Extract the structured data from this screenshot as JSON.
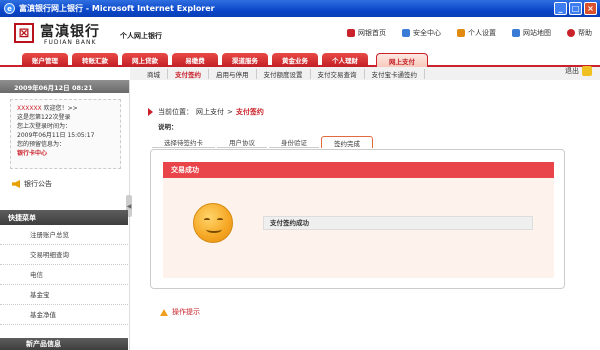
{
  "window": {
    "title": "富滇银行网上银行 - Microsoft Internet Explorer",
    "buttons": [
      "_",
      "□",
      "×"
    ]
  },
  "header": {
    "logo_text": "富滇银行",
    "logo_en": "FUDIAN BANK",
    "subtitle": "个人网上银行",
    "links": [
      {
        "label": "网银首页",
        "icon": "home-icon",
        "color": "#c9222a"
      },
      {
        "label": "安全中心",
        "icon": "shield-icon",
        "color": "#3a7bd5"
      },
      {
        "label": "个人设置",
        "icon": "user-icon",
        "color": "#e08a10"
      },
      {
        "label": "网站地图",
        "icon": "map-icon",
        "color": "#3a7bd5"
      },
      {
        "label": "帮助",
        "icon": "help-icon",
        "color": "#c9222a"
      }
    ]
  },
  "nav": {
    "tabs": [
      "账户管理",
      "转账汇款",
      "网上贷款",
      "易缴费",
      "渠道服务",
      "黄金业务",
      "个人理财",
      "网上支付"
    ],
    "active": "网上支付"
  },
  "subnav": {
    "items": [
      "商城",
      "支付签约",
      "启用与停用",
      "支付额度设置",
      "支付交易查询",
      "支付宝卡通签约"
    ],
    "current": "支付签约",
    "logout": "退出"
  },
  "sidebar": {
    "date": "2009年06月12日 08:21",
    "user": {
      "name": "XXXXXX",
      "greeting": "欢迎您！>>",
      "line1": "这是您第122次登录",
      "line2": "您上次登录时间为：",
      "line3": "2009年06月11日 15:05:17",
      "line4": "您的预留信息为：",
      "link": "银行卡中心"
    },
    "notice": "银行公告",
    "collapse_glyph": "◀",
    "quick_title": "快捷菜单",
    "quick_items": [
      "注册账户总览",
      "交易明细查询",
      "电信",
      "基金宝",
      "基金净值"
    ],
    "new_products": "新产品信息"
  },
  "main": {
    "location_prefix": "当前位置：",
    "location_path": "网上支付",
    "location_sep": ">",
    "location_current": "支付签约",
    "desc": "说明：",
    "steps": [
      "选择待签约卡",
      "用户协议",
      "身份验证",
      "签约完成"
    ],
    "active_step": "签约完成",
    "panel_title": "交易成功",
    "result": "支付签约成功",
    "tip": "操作提示"
  }
}
